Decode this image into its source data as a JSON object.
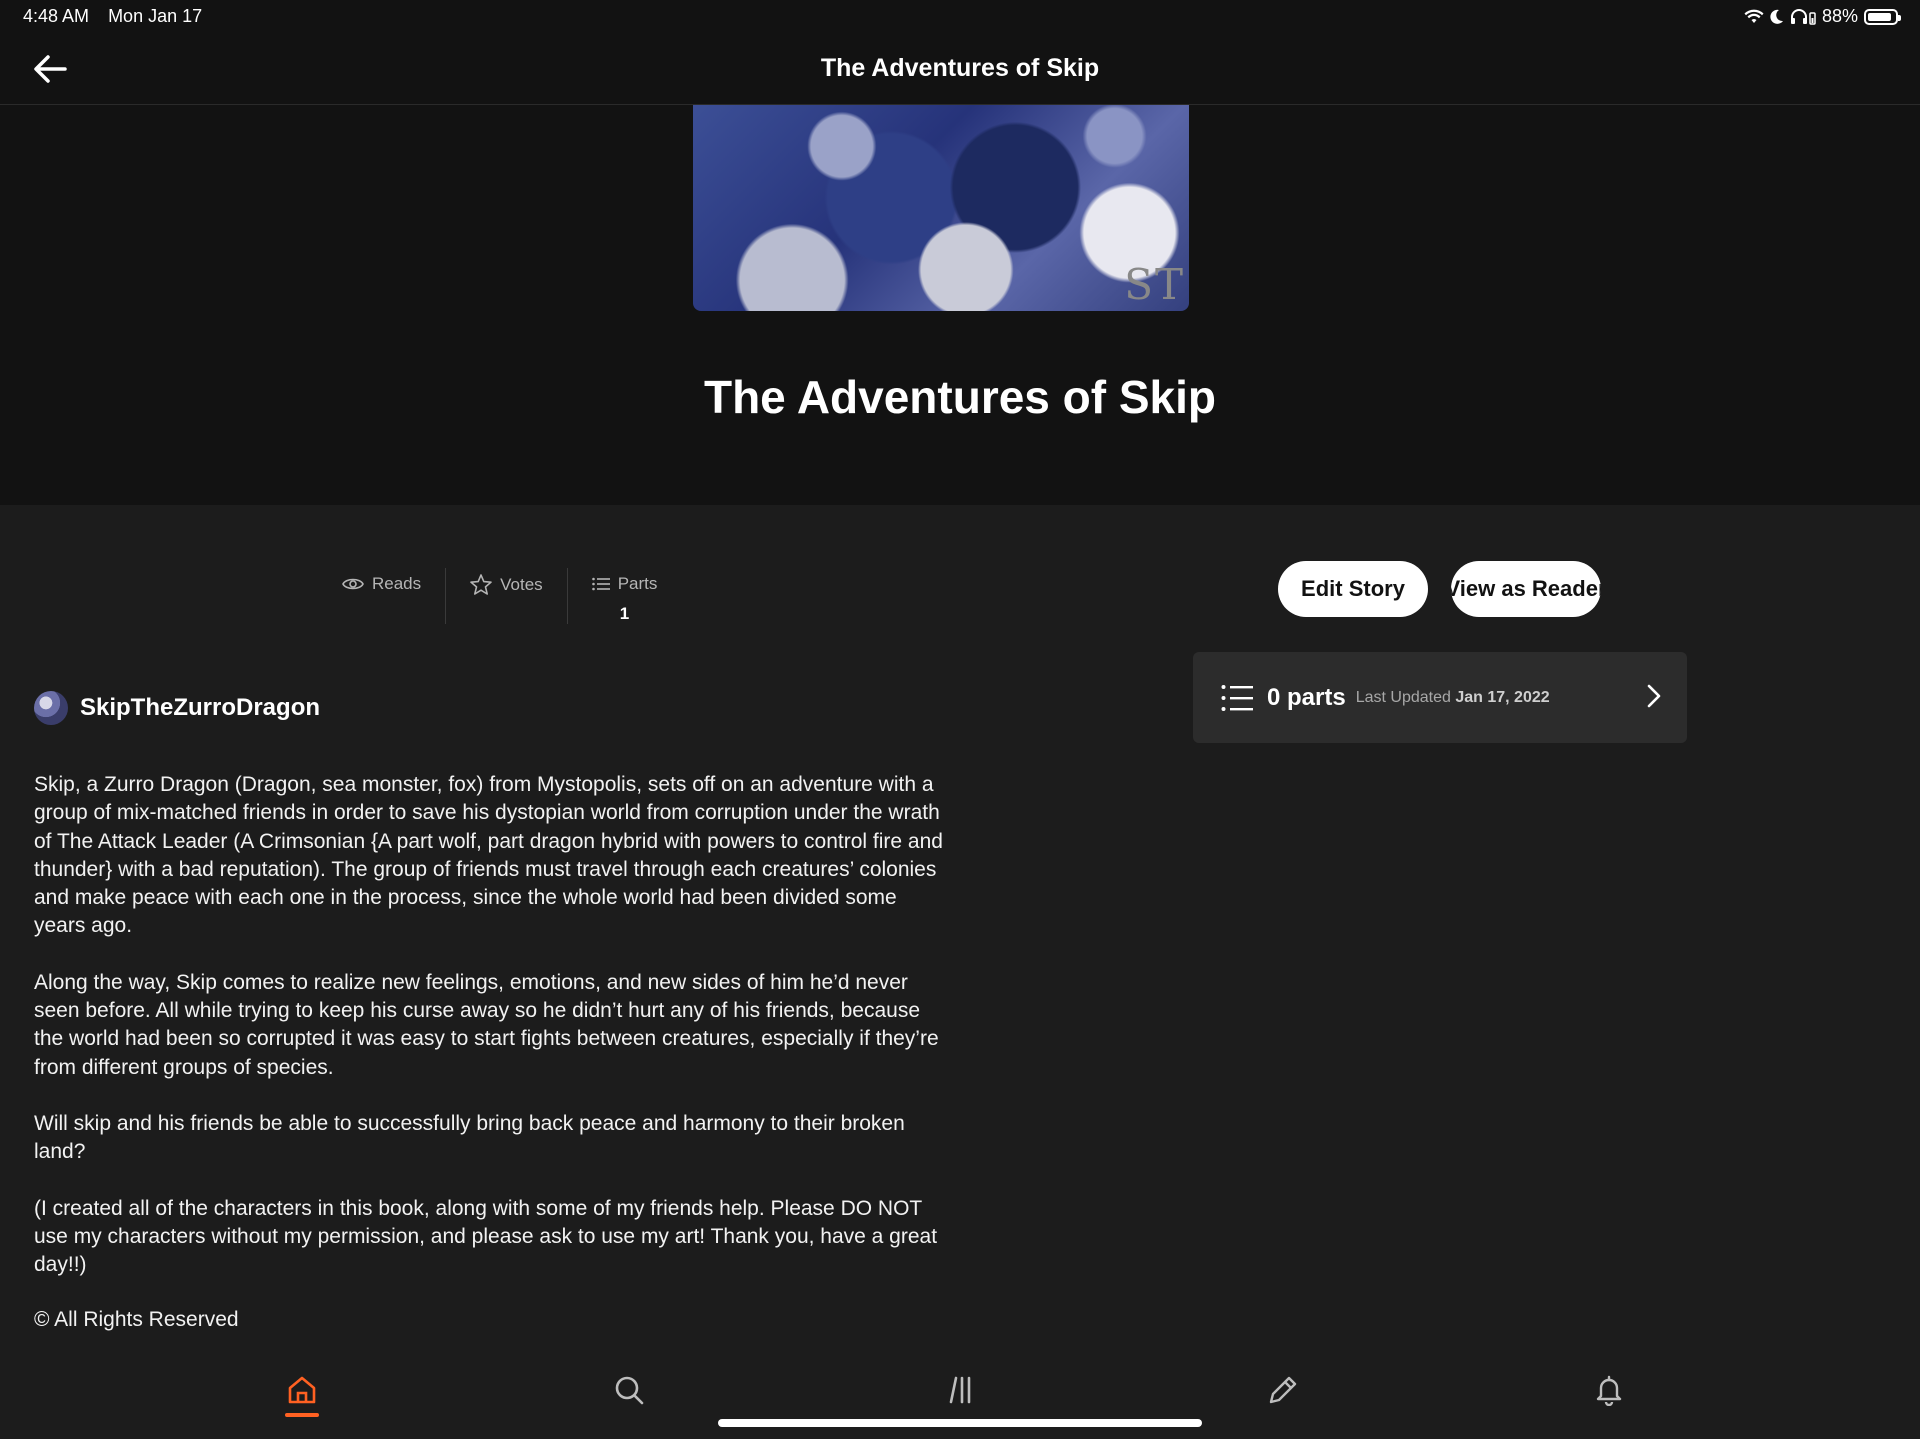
{
  "status_bar": {
    "time": "4:48 AM",
    "date": "Mon Jan 17",
    "battery": "88%",
    "battery_level": 0.88
  },
  "nav": {
    "title": "The Adventures of Skip",
    "back_icon": "arrow-left-icon"
  },
  "story": {
    "cover_text": "ST",
    "title": "The Adventures of Skip"
  },
  "stats": [
    {
      "icon": "eye-icon",
      "label": "Reads",
      "value": ""
    },
    {
      "icon": "star-icon",
      "label": "Votes",
      "value": ""
    },
    {
      "icon": "list-icon",
      "label": "Parts",
      "value": "1"
    }
  ],
  "actions": {
    "edit_label": "Edit Story",
    "view_label": "View as Reader"
  },
  "parts": {
    "count_label": "0 parts",
    "updated_prefix": "Last Updated",
    "updated_date": "Jan 17, 2022"
  },
  "author": {
    "name": "SkipTheZurroDragon"
  },
  "description": [
    "Skip, a Zurro Dragon (Dragon, sea monster, fox) from Mystopolis, sets off on an adventure with a group of mix-matched friends in order to save his dystopian world from corruption under the wrath of The Attack Leader (A Crimsonian {A part wolf, part dragon hybrid with powers to control fire and thunder} with a bad reputation). The group of friends must travel through each creatures’ colonies and make peace with each one in the process, since the whole world had been divided some years ago.",
    "Along the way, Skip comes to realize new feelings, emotions, and new sides of him he’d never seen before. All while trying to keep his curse away so he didn’t hurt any of his friends, because the world had been so corrupted it was easy to start fights between creatures, especially if they’re from different groups of species.",
    "Will skip and his friends be able to successfully bring back peace and harmony to their broken land?",
    "(I created all of the characters in this book, along with some of my friends help. Please DO NOT use my characters without my permission, and please ask to use my art! Thank you, have a great day!!)"
  ],
  "copyright": "© All Rights Reserved",
  "tabbar": {
    "active_tab": "home",
    "accent_color": "#ff6122",
    "tabs": [
      "home-icon",
      "search-icon",
      "library-icon",
      "pencil-icon",
      "bell-icon"
    ]
  }
}
